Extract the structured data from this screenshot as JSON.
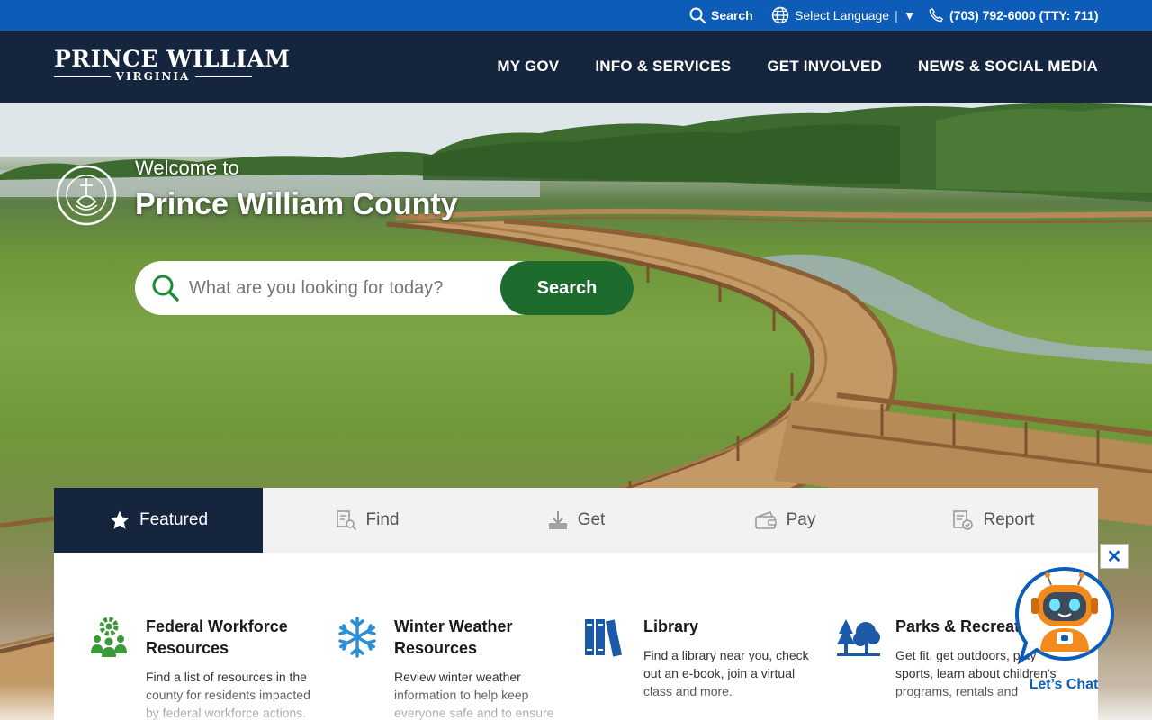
{
  "utility": {
    "search_label": "Search",
    "language_label": "Select Language",
    "language_arrow": "▼",
    "phone": "(703) 792-6000 (TTY: 711)"
  },
  "logo": {
    "main": "PRINCE WILLIAM",
    "sub": "VIRGINIA"
  },
  "nav": [
    {
      "label": "MY GOV"
    },
    {
      "label": "INFO & SERVICES"
    },
    {
      "label": "GET INVOLVED"
    },
    {
      "label": "NEWS & SOCIAL MEDIA"
    }
  ],
  "hero": {
    "welcome": "Welcome to",
    "title": "Prince William County",
    "search_placeholder": "What are you looking for today?",
    "search_button": "Search"
  },
  "tabs": [
    {
      "label": "Featured",
      "icon": "star-icon",
      "active": true
    },
    {
      "label": "Find",
      "icon": "find-document-icon",
      "active": false
    },
    {
      "label": "Get",
      "icon": "download-icon",
      "active": false
    },
    {
      "label": "Pay",
      "icon": "wallet-icon",
      "active": false
    },
    {
      "label": "Report",
      "icon": "report-icon",
      "active": false
    }
  ],
  "featured": [
    {
      "title": "Federal Workforce Resources",
      "description": "Find a list of resources in the county for residents impacted by federal workforce actions.",
      "icon": "people-gear-icon",
      "color": "#3a9a3a"
    },
    {
      "title": "Winter Weather Resources",
      "description": "Review winter weather information to help keep everyone safe and to ensure",
      "icon": "snowflake-icon",
      "color": "#2a8fd6"
    },
    {
      "title": "Library",
      "description": "Find a library near you, check out an e-book, join a virtual class and more.",
      "icon": "books-icon",
      "color": "#1c5aa8"
    },
    {
      "title": "Parks & Recreation",
      "description": "Get fit, get outdoors, play sports, learn about children's programs, rentals and",
      "icon": "trees-icon",
      "color": "#1c5aa8"
    }
  ],
  "chat": {
    "label": "Let’s Chat",
    "close": "✕"
  },
  "colors": {
    "utility_bar": "#0c5cb8",
    "header": "#14253d",
    "search_button": "#1e6b2e",
    "active_tab": "#14253d"
  }
}
